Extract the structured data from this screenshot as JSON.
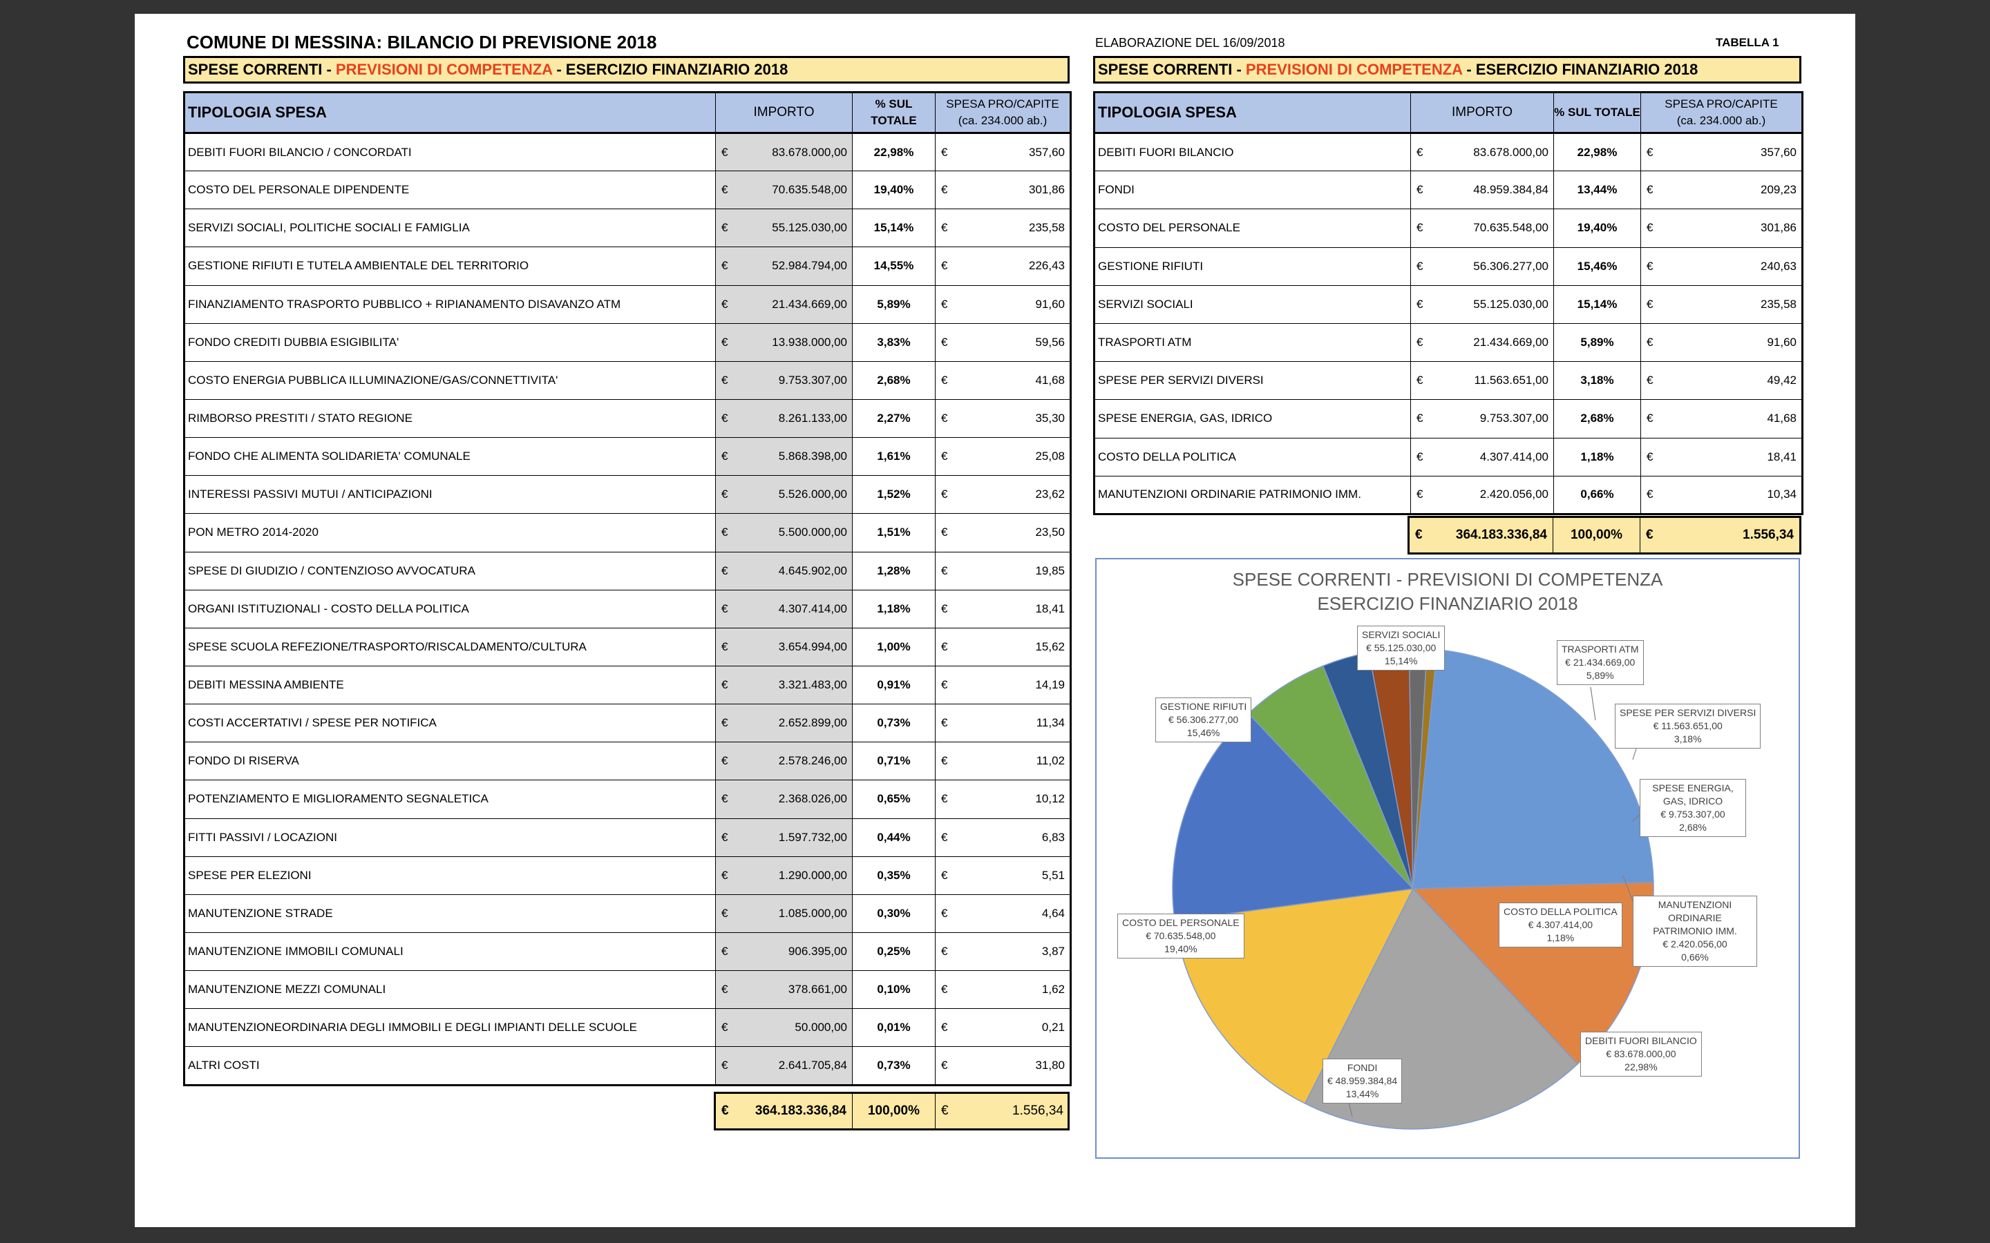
{
  "title": "COMUNE DI MESSINA: BILANCIO DI PREVISIONE 2018",
  "elaborazione": "ELABORAZIONE DEL 16/09/2018",
  "tabella": "TABELLA 1",
  "section_header": {
    "part1": "SPESE CORRENTI - ",
    "part2": "PREVISIONI DI COMPETENZA",
    "part3": " - ESERCIZIO FINANZIARIO 2018"
  },
  "colors": {
    "red_text": "#e8401c",
    "header_blue": "#b4c6e7",
    "total_yellow": "#fde9a6",
    "import_grey": "#d9d9d9"
  },
  "left_table": {
    "headers": {
      "tipologia": "TIPOLOGIA SPESA",
      "importo": "IMPORTO",
      "pct_1": "% SUL",
      "pct_2": "TOTALE",
      "pro_1": "SPESA PRO/CAPITE",
      "pro_2": "(ca. 234.000 ab.)"
    },
    "currency": "€",
    "rows": [
      {
        "label": "DEBITI FUORI BILANCIO / CONCORDATI",
        "importo": "83.678.000,00",
        "pct": "22,98%",
        "procapite": "357,60"
      },
      {
        "label": "COSTO DEL PERSONALE DIPENDENTE",
        "importo": "70.635.548,00",
        "pct": "19,40%",
        "procapite": "301,86"
      },
      {
        "label": "SERVIZI SOCIALI, POLITICHE SOCIALI E FAMIGLIA",
        "importo": "55.125.030,00",
        "pct": "15,14%",
        "procapite": "235,58"
      },
      {
        "label": "GESTIONE RIFIUTI E TUTELA AMBIENTALE DEL TERRITORIO",
        "importo": "52.984.794,00",
        "pct": "14,55%",
        "procapite": "226,43"
      },
      {
        "label": "FINANZIAMENTO TRASPORTO PUBBLICO + RIPIANAMENTO DISAVANZO ATM",
        "importo": "21.434.669,00",
        "pct": "5,89%",
        "procapite": "91,60"
      },
      {
        "label": "FONDO CREDITI DUBBIA ESIGIBILITA'",
        "importo": "13.938.000,00",
        "pct": "3,83%",
        "procapite": "59,56"
      },
      {
        "label": "COSTO ENERGIA PUBBLICA ILLUMINAZIONE/GAS/CONNETTIVITA'",
        "importo": "9.753.307,00",
        "pct": "2,68%",
        "procapite": "41,68"
      },
      {
        "label": "RIMBORSO PRESTITI / STATO REGIONE",
        "importo": "8.261.133,00",
        "pct": "2,27%",
        "procapite": "35,30"
      },
      {
        "label": "FONDO CHE ALIMENTA SOLIDARIETA' COMUNALE",
        "importo": "5.868.398,00",
        "pct": "1,61%",
        "procapite": "25,08"
      },
      {
        "label": "INTERESSI PASSIVI MUTUI / ANTICIPAZIONI",
        "importo": "5.526.000,00",
        "pct": "1,52%",
        "procapite": "23,62"
      },
      {
        "label": "PON METRO 2014-2020",
        "importo": "5.500.000,00",
        "pct": "1,51%",
        "procapite": "23,50"
      },
      {
        "label": "SPESE DI GIUDIZIO / CONTENZIOSO AVVOCATURA",
        "importo": "4.645.902,00",
        "pct": "1,28%",
        "procapite": "19,85"
      },
      {
        "label": "ORGANI ISTITUZIONALI - COSTO DELLA POLITICA",
        "importo": "4.307.414,00",
        "pct": "1,18%",
        "procapite": "18,41"
      },
      {
        "label": "SPESE SCUOLA REFEZIONE/TRASPORTO/RISCALDAMENTO/CULTURA",
        "importo": "3.654.994,00",
        "pct": "1,00%",
        "procapite": "15,62"
      },
      {
        "label": "DEBITI MESSINA AMBIENTE",
        "importo": "3.321.483,00",
        "pct": "0,91%",
        "procapite": "14,19"
      },
      {
        "label": "COSTI ACCERTATIVI / SPESE PER NOTIFICA",
        "importo": "2.652.899,00",
        "pct": "0,73%",
        "procapite": "11,34"
      },
      {
        "label": "FONDO DI RISERVA",
        "importo": "2.578.246,00",
        "pct": "0,71%",
        "procapite": "11,02"
      },
      {
        "label": "POTENZIAMENTO E MIGLIORAMENTO SEGNALETICA",
        "importo": "2.368.026,00",
        "pct": "0,65%",
        "procapite": "10,12"
      },
      {
        "label": "FITTI PASSIVI / LOCAZIONI",
        "importo": "1.597.732,00",
        "pct": "0,44%",
        "procapite": "6,83"
      },
      {
        "label": "SPESE PER ELEZIONI",
        "importo": "1.290.000,00",
        "pct": "0,35%",
        "procapite": "5,51"
      },
      {
        "label": "MANUTENZIONE STRADE",
        "importo": "1.085.000,00",
        "pct": "0,30%",
        "procapite": "4,64"
      },
      {
        "label": "MANUTENZIONE IMMOBILI COMUNALI",
        "importo": "906.395,00",
        "pct": "0,25%",
        "procapite": "3,87"
      },
      {
        "label": "MANUTENZIONE MEZZI COMUNALI",
        "importo": "378.661,00",
        "pct": "0,10%",
        "procapite": "1,62"
      },
      {
        "label": "MANUTENZIONEORDINARIA DEGLI IMMOBILI E DEGLI IMPIANTI  DELLE SCUOLE",
        "importo": "50.000,00",
        "pct": "0,01%",
        "procapite": "0,21"
      },
      {
        "label": "ALTRI COSTI",
        "importo": "2.641.705,84",
        "pct": "0,73%",
        "procapite": "31,80"
      }
    ],
    "total": {
      "importo": "364.183.336,84",
      "pct": "100,00%",
      "procapite": "1.556,34"
    }
  },
  "right_table": {
    "headers": {
      "tipologia": "TIPOLOGIA SPESA",
      "importo": "IMPORTO",
      "pct": "% SUL TOTALE",
      "pro_1": "SPESA PRO/CAPITE",
      "pro_2": "(ca. 234.000 ab.)"
    },
    "currency": "€",
    "rows": [
      {
        "label": "DEBITI FUORI BILANCIO",
        "importo": "83.678.000,00",
        "pct": "22,98%",
        "procapite": "357,60"
      },
      {
        "label": "FONDI",
        "importo": "48.959.384,84",
        "pct": "13,44%",
        "procapite": "209,23"
      },
      {
        "label": "COSTO DEL PERSONALE",
        "importo": "70.635.548,00",
        "pct": "19,40%",
        "procapite": "301,86"
      },
      {
        "label": "GESTIONE RIFIUTI",
        "importo": "56.306.277,00",
        "pct": "15,46%",
        "procapite": "240,63"
      },
      {
        "label": "SERVIZI SOCIALI",
        "importo": "55.125.030,00",
        "pct": "15,14%",
        "procapite": "235,58"
      },
      {
        "label": "TRASPORTI ATM",
        "importo": "21.434.669,00",
        "pct": "5,89%",
        "procapite": "91,60"
      },
      {
        "label": "SPESE PER SERVIZI DIVERSI",
        "importo": "11.563.651,00",
        "pct": "3,18%",
        "procapite": "49,42"
      },
      {
        "label": "SPESE ENERGIA, GAS, IDRICO",
        "importo": "9.753.307,00",
        "pct": "2,68%",
        "procapite": "41,68"
      },
      {
        "label": "COSTO DELLA POLITICA",
        "importo": "4.307.414,00",
        "pct": "1,18%",
        "procapite": "18,41"
      },
      {
        "label": "MANUTENZIONI ORDINARIE PATRIMONIO IMM.",
        "importo": "2.420.056,00",
        "pct": "0,66%",
        "procapite": "10,34"
      }
    ],
    "total": {
      "importo": "364.183.336,84",
      "pct": "100,00%",
      "procapite": "1.556,34"
    }
  },
  "chart_data": {
    "type": "pie",
    "title_line1": "SPESE CORRENTI - PREVISIONI DI COMPETENZA",
    "title_line2": "ESERCIZIO FINANZIARIO 2018",
    "slices": [
      {
        "name": "DEBITI FUORI BILANCIO",
        "value": 83678000.0,
        "amount": "€ 83.678.000,00",
        "pct": "22,98%",
        "color": "#6a98d4"
      },
      {
        "name": "FONDI",
        "value": 48959384.84,
        "amount": "€ 48.959.384,84",
        "pct": "13,44%",
        "color": "#e08444"
      },
      {
        "name": "COSTO DEL PERSONALE",
        "value": 70635548.0,
        "amount": "€ 70.635.548,00",
        "pct": "19,40%",
        "color": "#a5a5a5"
      },
      {
        "name": "GESTIONE RIFIUTI",
        "value": 56306277.0,
        "amount": "€ 56.306.277,00",
        "pct": "15,46%",
        "color": "#f5c140"
      },
      {
        "name": "SERVIZI SOCIALI",
        "value": 55125030.0,
        "amount": "€ 55.125.030,00",
        "pct": "15,14%",
        "color": "#4c74c4"
      },
      {
        "name": "TRASPORTI ATM",
        "value": 21434669.0,
        "amount": "€ 21.434.669,00",
        "pct": "5,89%",
        "color": "#74aa4c"
      },
      {
        "name": "SPESE PER SERVIZI DIVERSI",
        "value": 11563651.0,
        "amount": "€ 11.563.651,00",
        "pct": "3,18%",
        "color": "#2f5a94"
      },
      {
        "name": "SPESE ENERGIA, GAS, IDRICO",
        "value": 9753307.0,
        "amount": "€ 9.753.307,00",
        "pct": "2,68%",
        "color": "#9c4a1e"
      },
      {
        "name": "COSTO DELLA POLITICA",
        "value": 4307414.0,
        "amount": "€ 4.307.414,00",
        "pct": "1,18%",
        "color": "#6a6a6a"
      },
      {
        "name": "MANUTENZIONI ORDINARIE PATRIMONIO IMM.",
        "value": 2420056.0,
        "amount": "€ 2.420.056,00",
        "pct": "0,66%",
        "color": "#a0781e"
      }
    ]
  }
}
